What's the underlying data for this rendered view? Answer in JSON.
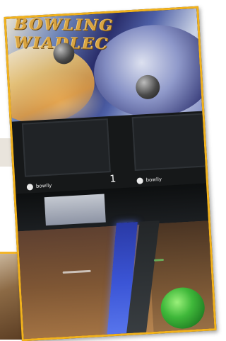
{
  "photo": {
    "mural_text": "BOWLING WIADLEC",
    "lane_number": "1",
    "brand_left": "bowlly",
    "brand_right": "bowlly"
  },
  "colors": {
    "frame": "#f2b21c",
    "gutter_light": "#3b55d6",
    "ball": "#3fb83a"
  }
}
